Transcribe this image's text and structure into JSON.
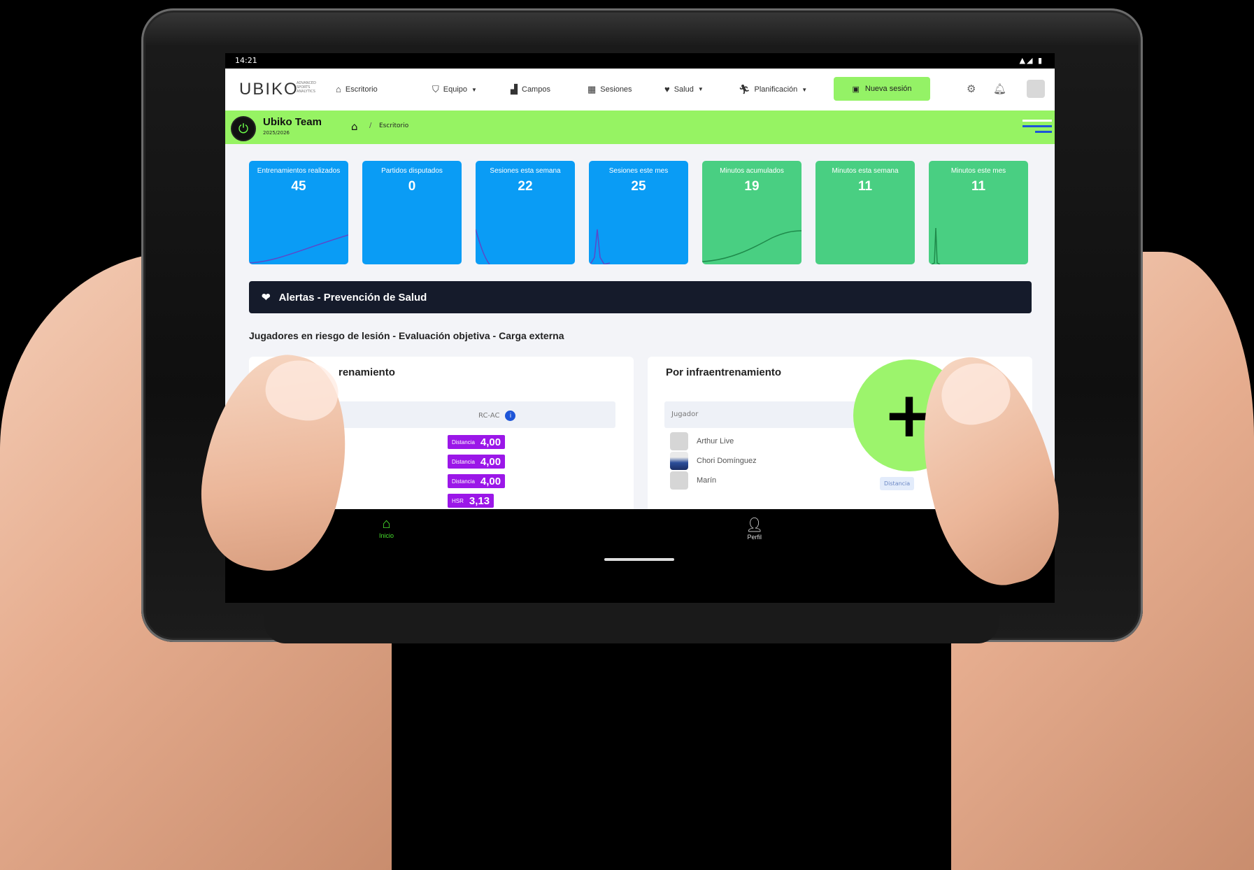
{
  "status_bar": {
    "time": "14:21",
    "system": "▲◢ ▮"
  },
  "nav": {
    "logo": "UBIKO",
    "logo_sub": "ADVANCED SPORTS ANALYTICS",
    "items": [
      {
        "label": "Escritorio",
        "icon": "home-icon"
      },
      {
        "label": "Equipo",
        "icon": "shield-icon",
        "dropdown": true
      },
      {
        "label": "Campos",
        "icon": "stadium-icon"
      },
      {
        "label": "Sesiones",
        "icon": "calendar-icon"
      },
      {
        "label": "Salud",
        "icon": "heart-icon",
        "dropdown": true
      },
      {
        "label": "Planificación",
        "icon": "runner-icon",
        "dropdown": true
      }
    ],
    "new_session_label": "Nueva sesión"
  },
  "team": {
    "name": "Ubiko Team",
    "season": "2025/2026",
    "breadcrumb": "Escritorio"
  },
  "stats": [
    {
      "label": "Entrenamientos realizados",
      "value": "45",
      "color": "#0a9cf5"
    },
    {
      "label": "Partidos disputados",
      "value": "0",
      "color": "#0a9cf5"
    },
    {
      "label": "Sesiones esta semana",
      "value": "22",
      "color": "#0a9cf5"
    },
    {
      "label": "Sesiones este mes",
      "value": "25",
      "color": "#0a9cf5"
    },
    {
      "label": "Minutos acumulados",
      "value": "19",
      "color": "#49cf82"
    },
    {
      "label": "Minutos esta semana",
      "value": "11",
      "color": "#49cf82"
    },
    {
      "label": "Minutos este mes",
      "value": "11",
      "color": "#49cf82"
    }
  ],
  "alerts": {
    "title": "Alertas - Prevención de Salud",
    "subtitle": "Jugadores en riesgo de lesión - Evaluación objetiva - Carga externa"
  },
  "left_panel": {
    "title_partial": "renamiento",
    "column_rcac": "RC-AC",
    "rows": [
      {
        "metric": "Distancia",
        "value": "4,00"
      },
      {
        "metric": "Distancia",
        "value": "4,00"
      },
      {
        "metric": "Distancia",
        "value": "4,00"
      },
      {
        "metric": "HSR",
        "value": "3,13"
      }
    ]
  },
  "right_panel": {
    "title": "Por infraentrenamiento",
    "column_player": "Jugador",
    "players": [
      {
        "name": "Arthur Live"
      },
      {
        "name": "Chori Domínguez"
      },
      {
        "name": "Marín"
      }
    ],
    "distance_badge": "Distancia"
  },
  "bottom_nav": {
    "home_label": "Inicio",
    "profile_label": "Perfil"
  },
  "fab": {
    "label": "+"
  },
  "colors": {
    "accent_green": "#96f363",
    "blue_card": "#0a9cf5",
    "green_card": "#49cf82",
    "alerts_dark": "#151b2b",
    "badge_purple": "#9b17e8"
  }
}
